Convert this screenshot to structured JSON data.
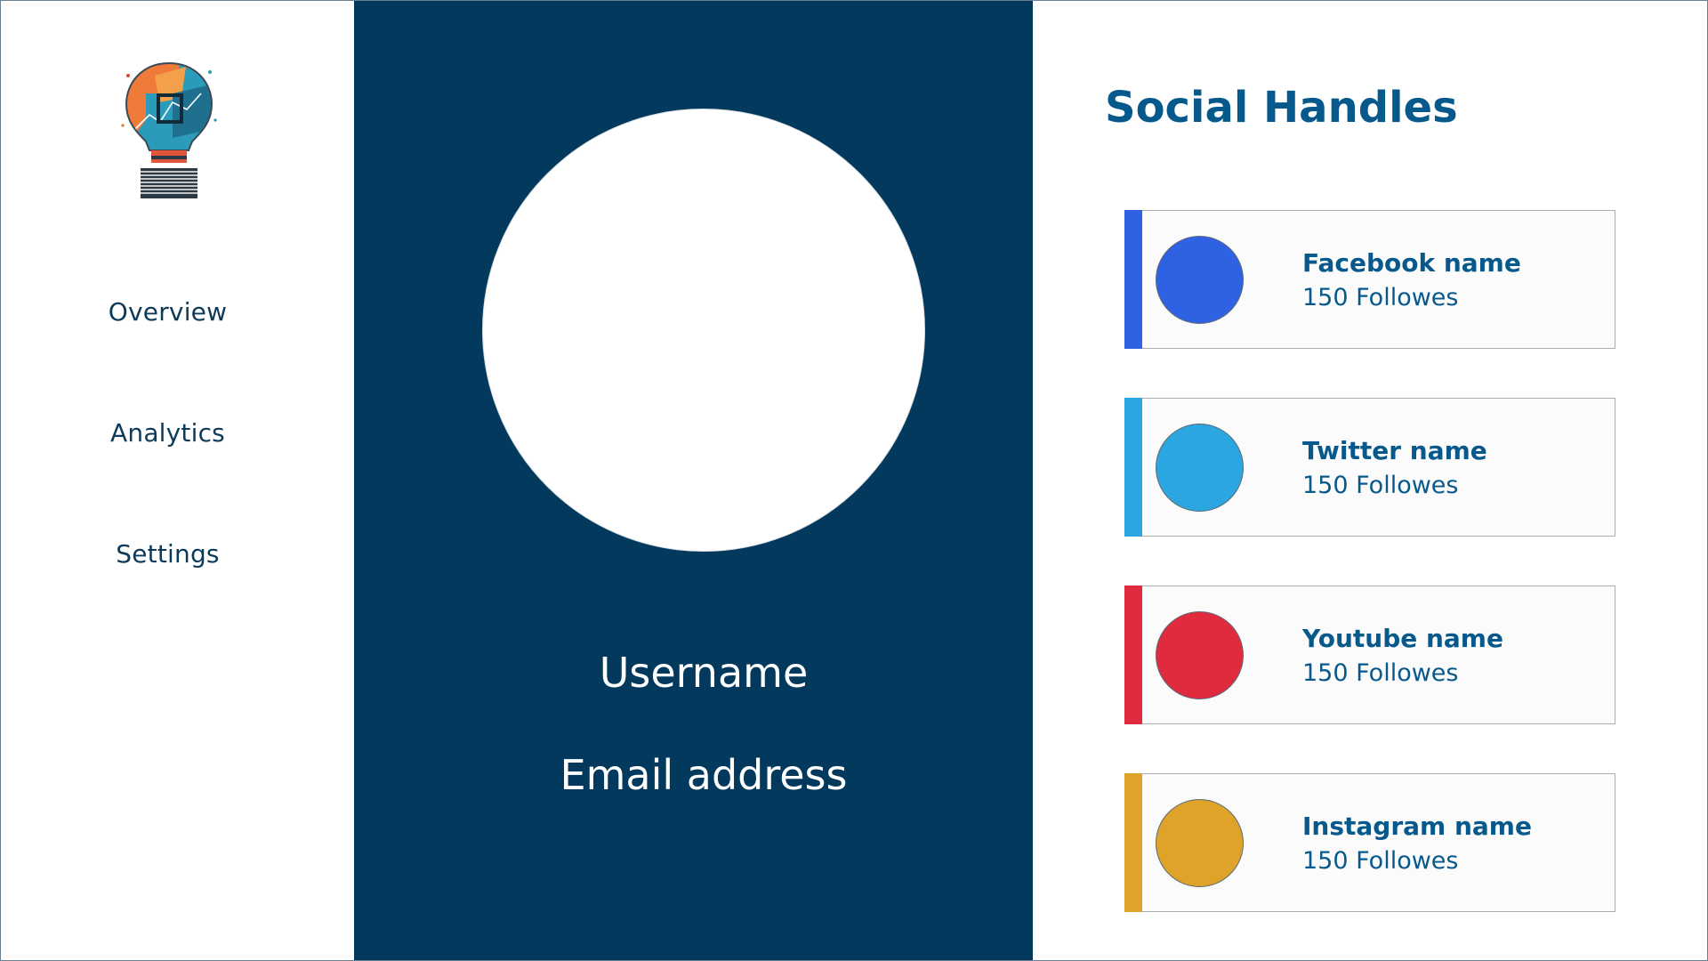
{
  "nav": {
    "items": [
      {
        "label": "Overview"
      },
      {
        "label": "Analytics"
      },
      {
        "label": "Settings"
      }
    ]
  },
  "profile": {
    "username": "Username",
    "email": "Email address"
  },
  "social": {
    "title": "Social Handles",
    "handles": [
      {
        "name": "Facebook name",
        "followers": "150 Followes",
        "color": "#2f62e2",
        "icon": "facebook-icon"
      },
      {
        "name": "Twitter name",
        "followers": "150 Followes",
        "color": "#2ca6e0",
        "icon": "twitter-icon"
      },
      {
        "name": "Youtube name",
        "followers": "150 Followes",
        "color": "#e02a3d",
        "icon": "youtube-icon"
      },
      {
        "name": "Instagram name",
        "followers": "150 Followes",
        "color": "#e0a32a",
        "icon": "instagram-icon"
      }
    ]
  },
  "colors": {
    "profile_bg": "#02395c",
    "accent_text": "#07598c",
    "nav_text": "#0e3a5a"
  }
}
